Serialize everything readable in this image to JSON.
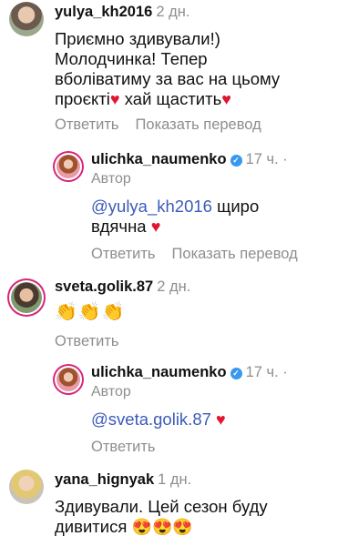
{
  "comments": [
    {
      "username": "yulya_kh2016",
      "time": "2 дн.",
      "text": "Приємно здивували!) Молодчинка! Тепер вболіватиму за вас на цьому проєкті",
      "text_tail": "хай щастить",
      "reply_label": "Ответить",
      "translate_label": "Показать перевод"
    },
    {
      "username": "ulichka_naumenko",
      "time": "17 ч. ·",
      "author_label": "Автор",
      "mention": "@yulya_kh2016",
      "text": "щиро вдячна",
      "reply_label": "Ответить",
      "translate_label": "Показать перевод"
    },
    {
      "username": "sveta.golik.87",
      "time": "2 дн.",
      "text": "👏👏👏",
      "reply_label": "Ответить"
    },
    {
      "username": "ulichka_naumenko",
      "time": "17 ч. ·",
      "author_label": "Автор",
      "mention": "@sveta.golik.87",
      "reply_label": "Ответить"
    },
    {
      "username": "yana_hignyak",
      "time": "1 дн.",
      "text": "Здивували. Цей сезон буду дивитися"
    }
  ],
  "icons": {
    "heart": "♥",
    "verified": "✓",
    "face": "😍"
  },
  "colors": {
    "mention": "#3b5bb8",
    "heart": "#e0152f",
    "verified": "#3897f0",
    "meta": "#8e8e8e",
    "story_ring": "#d6267a"
  }
}
